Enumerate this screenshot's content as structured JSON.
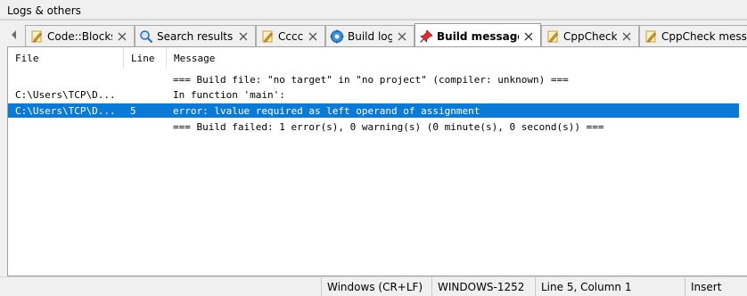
{
  "panel": {
    "title": "Logs & others"
  },
  "tabs": [
    {
      "label": "Code::Blocks",
      "icon": "note-pencil-icon",
      "active": false,
      "closable": true
    },
    {
      "label": "Search results",
      "icon": "magnifier-icon",
      "active": false,
      "closable": true
    },
    {
      "label": "Cccc",
      "icon": "note-pencil-icon",
      "active": false,
      "closable": true
    },
    {
      "label": "Build log",
      "icon": "gear-icon",
      "active": false,
      "closable": true
    },
    {
      "label": "Build messages",
      "icon": "pushpin-icon",
      "active": true,
      "closable": true
    },
    {
      "label": "CppCheck",
      "icon": "note-pencil-icon",
      "active": false,
      "closable": true
    },
    {
      "label": "CppCheck messages",
      "icon": "note-pencil-icon",
      "active": false,
      "closable": false
    }
  ],
  "messages": {
    "columns": {
      "file": "File",
      "line": "Line",
      "message": "Message"
    },
    "rows": [
      {
        "file": "",
        "line": "",
        "message": "=== Build file: \"no target\" in \"no project\" (compiler: unknown) ===",
        "selected": false
      },
      {
        "file": "C:\\Users\\TCP\\D...",
        "line": "",
        "message": "In function 'main':",
        "selected": false
      },
      {
        "file": "C:\\Users\\TCP\\D...",
        "line": "5",
        "message": "error: lvalue required as left operand of assignment",
        "selected": true
      },
      {
        "file": "",
        "line": "",
        "message": "=== Build failed: 1 error(s), 0 warning(s) (0 minute(s), 0 second(s)) ===",
        "selected": false
      }
    ]
  },
  "statusbar": {
    "line_endings": "Windows (CR+LF)",
    "encoding": "WINDOWS-1252",
    "position": "Line 5, Column 1",
    "mode": "Insert"
  },
  "colors": {
    "selection": "#0a7ad8",
    "panel_bg": "#f0f0f0",
    "content_bg": "#ffffff"
  }
}
